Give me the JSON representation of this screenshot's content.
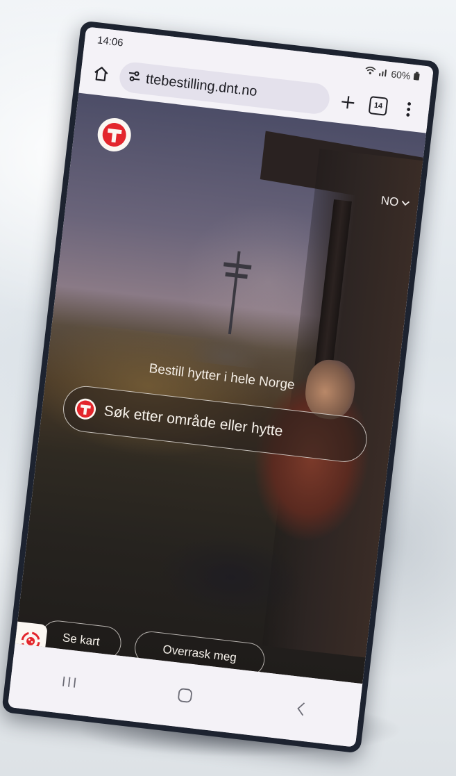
{
  "status": {
    "time": "14:06",
    "signal": "☢ .∥l 60%▴"
  },
  "browser": {
    "url": "ttebestilling.dnt.no",
    "tab_count": "14"
  },
  "page": {
    "language": "NO",
    "tagline": "Bestill hytter i hele Norge",
    "search_label": "Søk etter område eller hytte",
    "map_button": "Se kart",
    "surprise_button": "Overrask meg"
  },
  "colors": {
    "brand_red": "#e3262c",
    "cream": "#fbf7f2"
  }
}
